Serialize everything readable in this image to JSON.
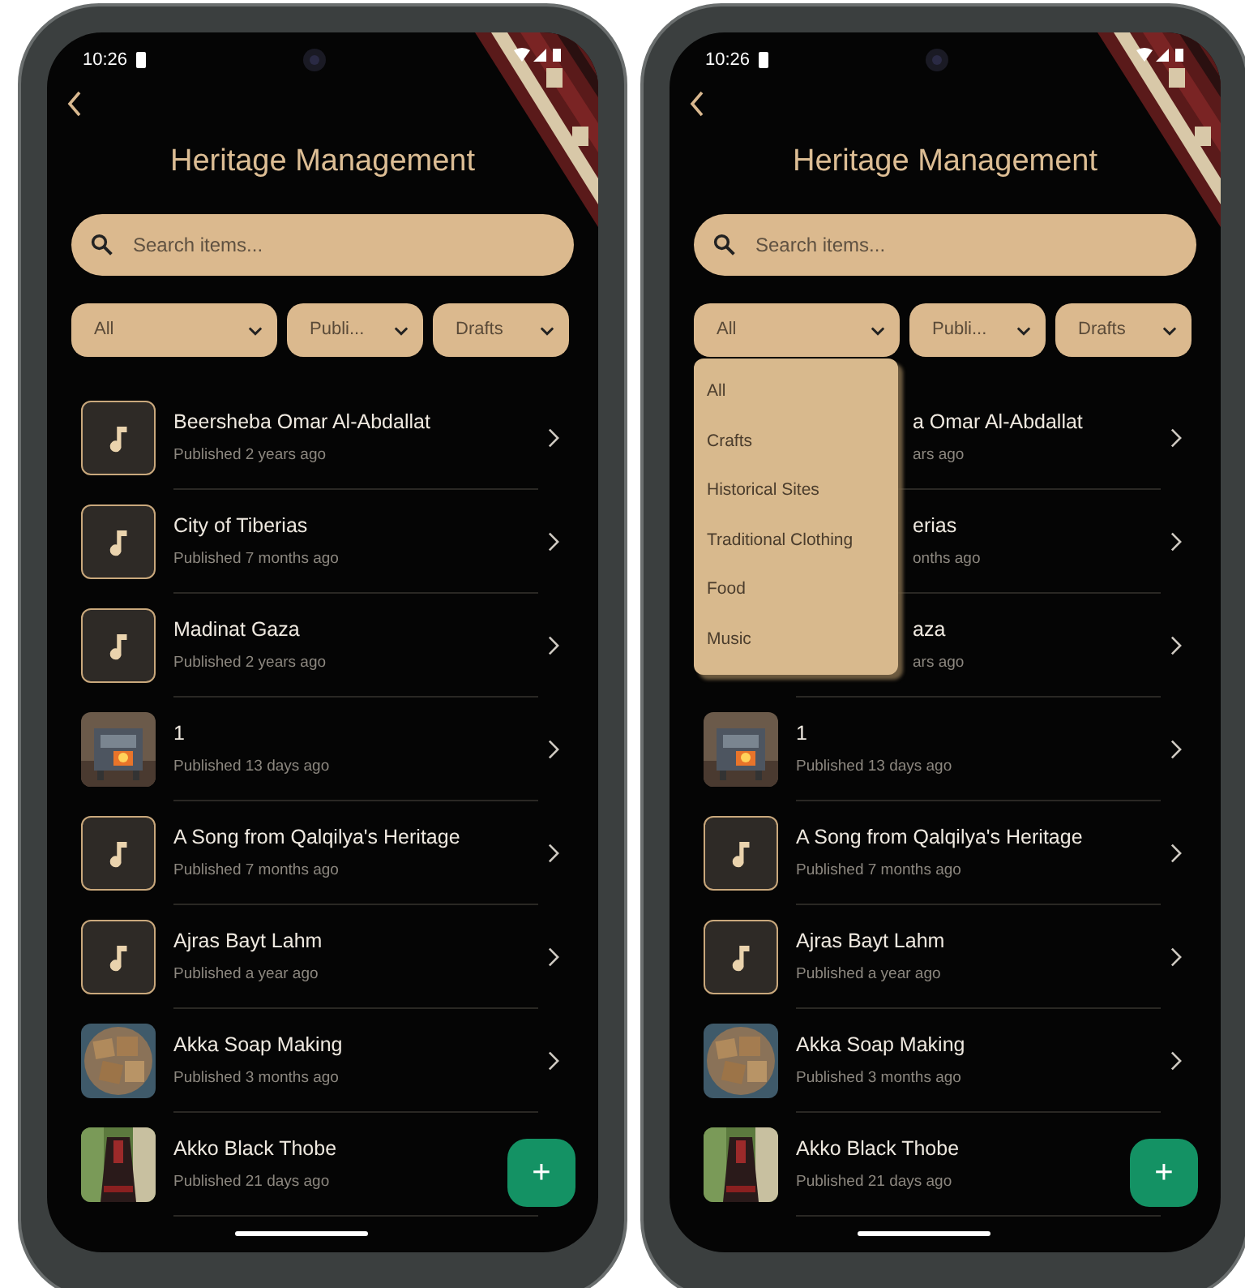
{
  "phones": [
    {
      "status_time": "10:26",
      "title": "Heritage Management",
      "search": {
        "placeholder": "Search items..."
      },
      "filters": [
        {
          "label": "All"
        },
        {
          "label": "Publi..."
        },
        {
          "label": "Drafts"
        }
      ],
      "items": [
        {
          "title": "Beersheba  Omar Al-Abdallat",
          "subtitle": "Published 2 years ago",
          "kind": "music"
        },
        {
          "title": "City of Tiberias",
          "subtitle": "Published 7 months ago",
          "kind": "music"
        },
        {
          "title": "Madinat Gaza",
          "subtitle": "Published 2 years ago",
          "kind": "music"
        },
        {
          "title": "1",
          "subtitle": "Published 13 days ago"
        },
        {
          "title": "A Song from Qalqilya's Heritage",
          "subtitle": "Published 7 months ago",
          "kind": "music"
        },
        {
          "title": "Ajras Bayt Lahm",
          "subtitle": "Published a year ago",
          "kind": "music"
        },
        {
          "title": "Akka Soap Making",
          "subtitle": "Published 3 months ago"
        },
        {
          "title": "Akko Black Thobe",
          "subtitle": "Published 21 days ago"
        }
      ],
      "fab": "+"
    },
    {
      "status_time": "10:26",
      "title": "Heritage Management",
      "search": {
        "placeholder": "Search items..."
      },
      "filters": [
        {
          "label": "All"
        },
        {
          "label": "Publi..."
        },
        {
          "label": "Drafts"
        }
      ],
      "dropdown": {
        "options": [
          "All",
          "Crafts",
          "Historical Sites",
          "Traditional Clothing",
          "Food",
          "Music"
        ]
      },
      "items": [
        {
          "title": "a Omar Al-Abdallat",
          "subtitle": "ars ago",
          "covered": true
        },
        {
          "title": "erias",
          "subtitle": "onths ago",
          "covered": true
        },
        {
          "title": "aza",
          "subtitle": "ars ago",
          "covered": true
        },
        {
          "title": "1",
          "subtitle": "Published 13 days ago"
        },
        {
          "title": "A Song from Qalqilya's Heritage",
          "subtitle": "Published 7 months ago",
          "kind": "music"
        },
        {
          "title": "Ajras Bayt Lahm",
          "subtitle": "Published a year ago",
          "kind": "music"
        },
        {
          "title": "Akka Soap Making",
          "subtitle": "Published 3 months ago"
        },
        {
          "title": "Akko Black Thobe",
          "subtitle": "Published 21 days ago"
        }
      ],
      "fab": "+"
    }
  ]
}
